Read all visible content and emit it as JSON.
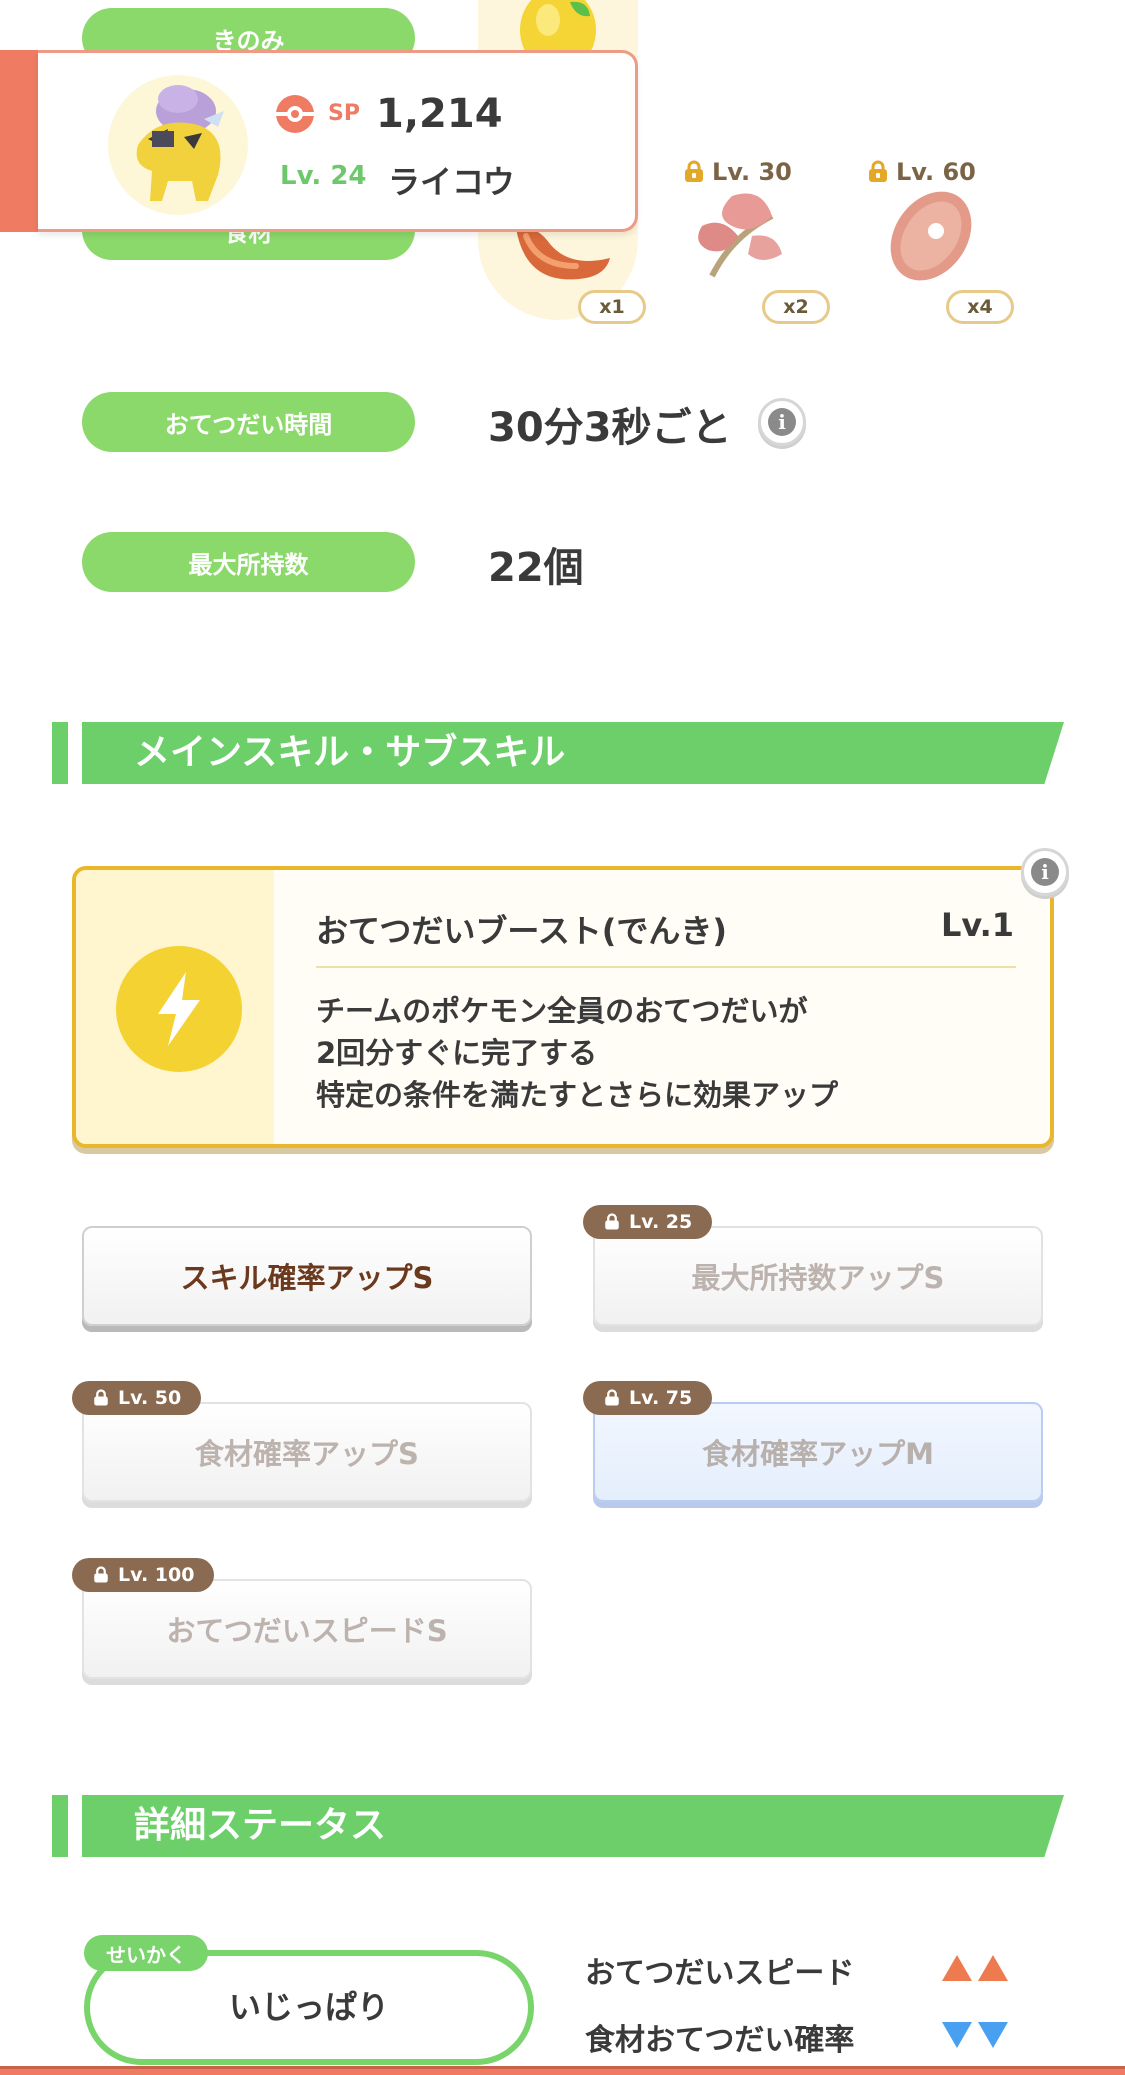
{
  "pills": {
    "berry": "きのみ",
    "ingredient": "食材",
    "help_time": "おてつだい時間",
    "max_carry": "最大所持数"
  },
  "ingredients": [
    {
      "icon": "sausage-icon",
      "qty": "x1",
      "lock": ""
    },
    {
      "icon": "herb-icon",
      "qty": "x2",
      "lock": "Lv. 30"
    },
    {
      "icon": "ham-icon",
      "qty": "x4",
      "lock": "Lv. 60"
    }
  ],
  "help_time_value": "30分3秒ごと",
  "max_carry_value": "22個",
  "section_skills": "メインスキル・サブスキル",
  "main_skill": {
    "name": "おてつだいブースト(でんき)",
    "level": "Lv.1",
    "desc": [
      "チームのポケモン全員のおてつだいが",
      "2回分すぐに完了する",
      "特定の条件を満たすとさらに効果アップ"
    ]
  },
  "sub_skills": [
    {
      "label": "スキル確率アップS",
      "lock": ""
    },
    {
      "label": "最大所持数アップS",
      "lock": "Lv. 25"
    },
    {
      "label": "食材確率アップS",
      "lock": "Lv. 50"
    },
    {
      "label": "食材確率アップM",
      "lock": "Lv. 75"
    },
    {
      "label": "おてつだいスピードS",
      "lock": "Lv. 100"
    }
  ],
  "section_status": "詳細ステータス",
  "nature": {
    "tag": "せいかく",
    "value": "いじっぱり"
  },
  "effects": [
    {
      "label": "おてつだいスピード",
      "direction": "up"
    },
    {
      "label": "食材おてつだい確率",
      "direction": "down"
    }
  ],
  "header": {
    "sp_label": "SP",
    "sp_value": "1,214",
    "level": "Lv. 24",
    "name": "ライコウ"
  },
  "colors": {
    "green": "#8bd96a",
    "accent": "#ee7b62",
    "up": "#ee7b50",
    "down": "#4aa0f0"
  }
}
